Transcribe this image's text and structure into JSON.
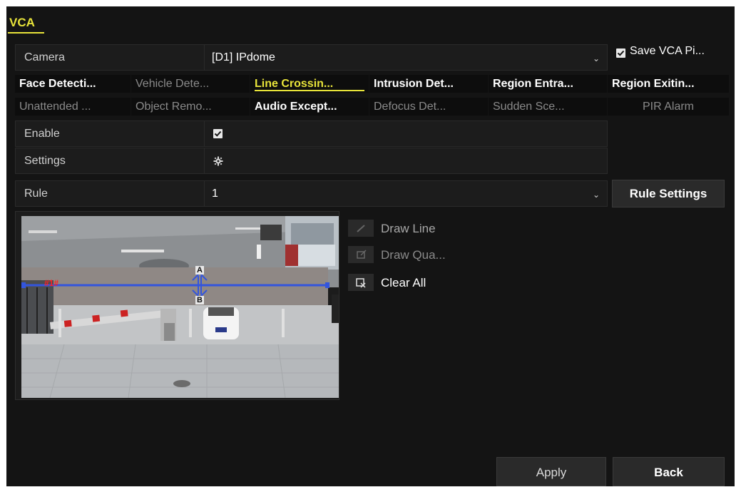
{
  "window": {
    "title": "VCA"
  },
  "camera": {
    "label": "Camera",
    "value": "[D1] IPdome"
  },
  "save_vca": {
    "label": "Save VCA Pi..."
  },
  "tabs_row1": [
    {
      "label": "Face Detecti...",
      "state": "on"
    },
    {
      "label": "Vehicle Dete...",
      "state": "off"
    },
    {
      "label": "Line Crossin...",
      "state": "sel"
    },
    {
      "label": "Intrusion Det...",
      "state": "on"
    },
    {
      "label": "Region Entra...",
      "state": "on"
    },
    {
      "label": "Region Exitin...",
      "state": "on"
    }
  ],
  "tabs_row2": [
    {
      "label": "Unattended ...",
      "state": "off"
    },
    {
      "label": "Object Remo...",
      "state": "off"
    },
    {
      "label": "Audio Except...",
      "state": "on"
    },
    {
      "label": "Defocus Det...",
      "state": "off"
    },
    {
      "label": "Sudden Sce...",
      "state": "off"
    },
    {
      "label": "PIR Alarm",
      "state": "off"
    }
  ],
  "enable": {
    "label": "Enable",
    "checked": true
  },
  "settings": {
    "label": "Settings",
    "icon": "gear-icon"
  },
  "rule": {
    "label": "Rule",
    "value": "1",
    "button": "Rule Settings"
  },
  "preview": {
    "line_id": "#1#",
    "side_a": "A",
    "side_b": "B"
  },
  "tools": {
    "draw_line": "Draw Line",
    "draw_quad": "Draw Qua...",
    "clear_all": "Clear All"
  },
  "footer": {
    "apply": "Apply",
    "back": "Back"
  },
  "colors": {
    "accent": "#e8e43a",
    "panel": "#141414",
    "line": "#3355dd",
    "marker": "#ff2020"
  }
}
